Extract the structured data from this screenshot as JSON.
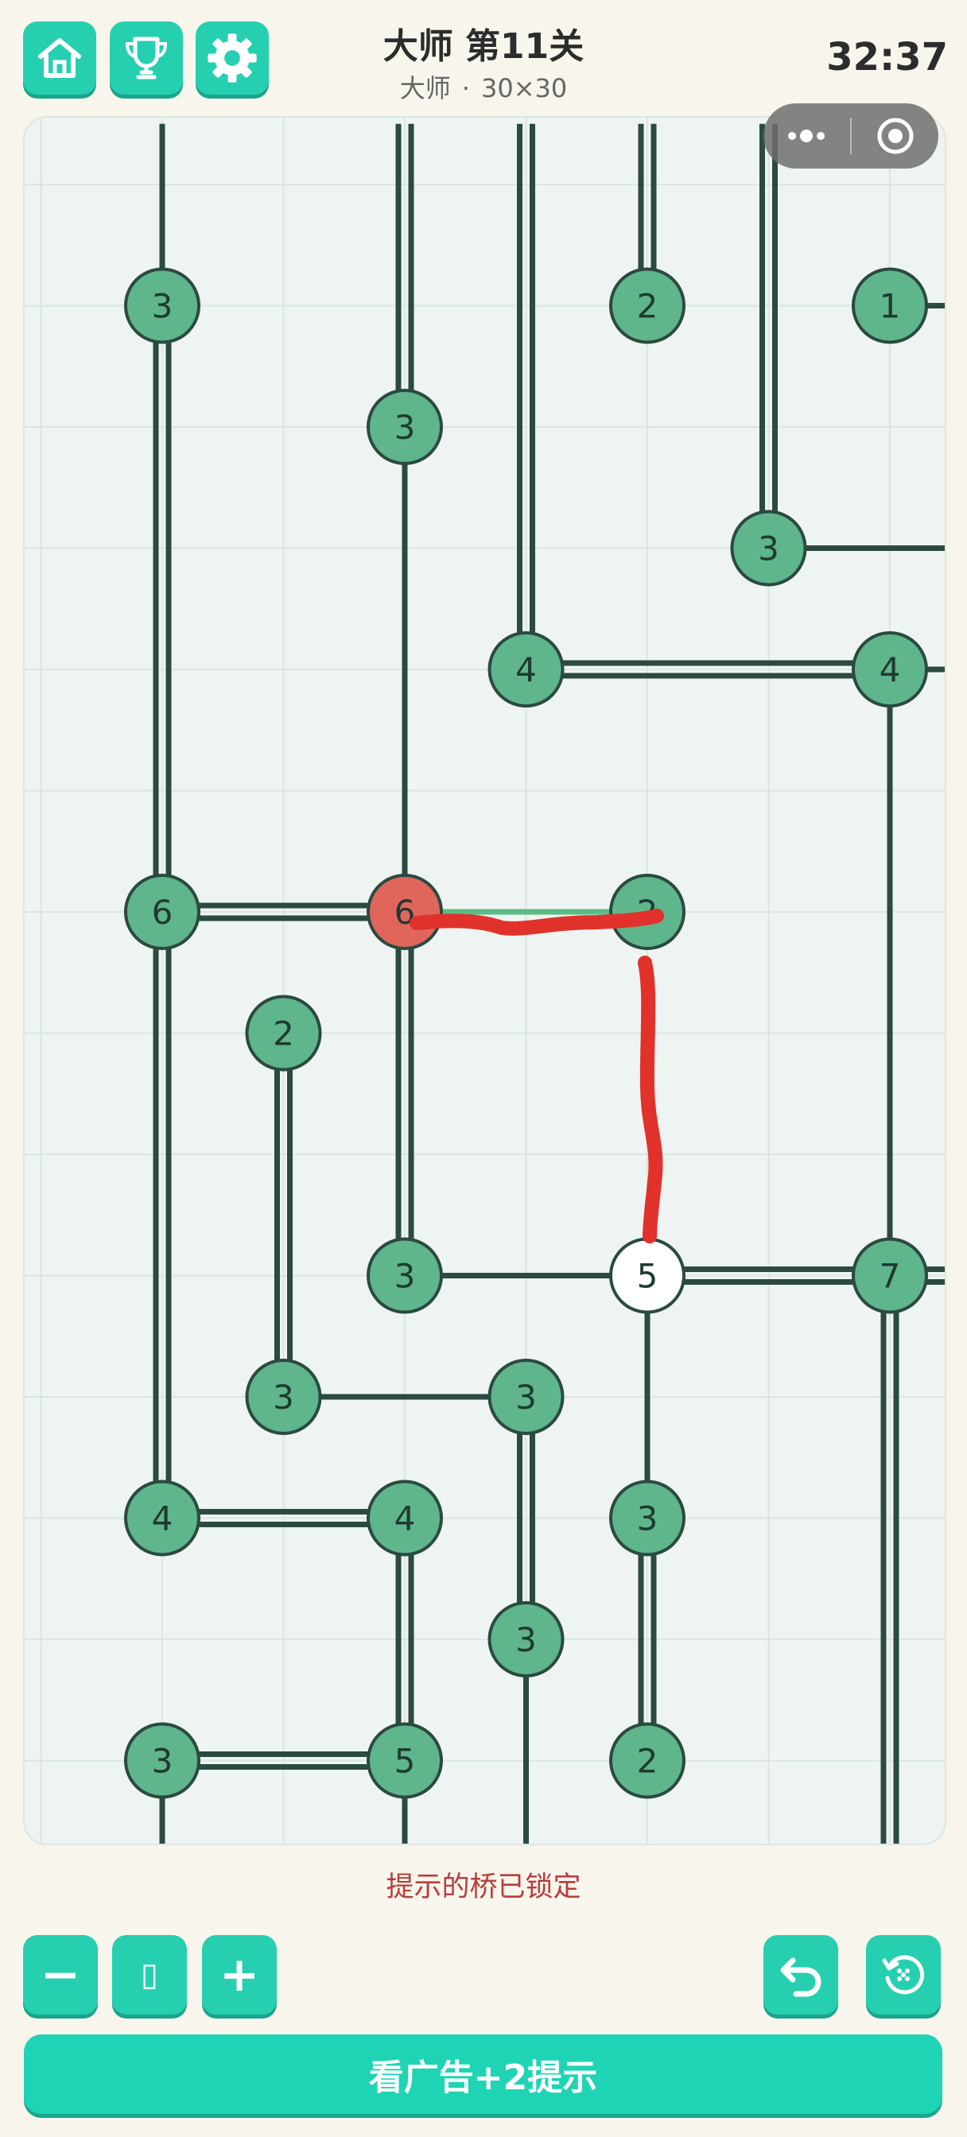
{
  "header": {
    "title": "大师 第11关",
    "difficulty": "大师",
    "separator": "·",
    "grid_size": "30×30",
    "timer": "32:37"
  },
  "toolbar_top": [
    {
      "name": "home-button",
      "icon": "home-icon"
    },
    {
      "name": "trophy-button",
      "icon": "trophy-icon"
    },
    {
      "name": "settings-button",
      "icon": "gear-icon"
    }
  ],
  "capsule": {
    "more_icon": "more-icon",
    "close_icon": "target-icon"
  },
  "colors": {
    "accent": "#27cfb1",
    "island_fill": "#5fb58c",
    "island_selected": "#e0665c",
    "island_active": "#ffffff",
    "bridge": "#2b4a40",
    "hint_bridge": "#5dbb86",
    "scribble": "#e0322a",
    "board_bg": "#eef4f1"
  },
  "islands": [
    {
      "col": 1,
      "row": 2,
      "value": "3",
      "state": "normal"
    },
    {
      "col": 5,
      "row": 2,
      "value": "2",
      "state": "normal"
    },
    {
      "col": 7,
      "row": 2,
      "value": "1",
      "state": "normal"
    },
    {
      "col": 3,
      "row": 3,
      "value": "3",
      "state": "normal"
    },
    {
      "col": 6,
      "row": 4,
      "value": "3",
      "state": "normal"
    },
    {
      "col": 4,
      "row": 5,
      "value": "4",
      "state": "normal"
    },
    {
      "col": 7,
      "row": 5,
      "value": "4",
      "state": "normal"
    },
    {
      "col": 1,
      "row": 7,
      "value": "6",
      "state": "normal"
    },
    {
      "col": 3,
      "row": 7,
      "value": "6",
      "state": "selected"
    },
    {
      "col": 5,
      "row": 7,
      "value": "2",
      "state": "normal"
    },
    {
      "col": 2,
      "row": 8,
      "value": "2",
      "state": "normal"
    },
    {
      "col": 3,
      "row": 10,
      "value": "3",
      "state": "normal"
    },
    {
      "col": 5,
      "row": 10,
      "value": "5",
      "state": "active"
    },
    {
      "col": 7,
      "row": 10,
      "value": "7",
      "state": "normal"
    },
    {
      "col": 2,
      "row": 11,
      "value": "3",
      "state": "normal"
    },
    {
      "col": 4,
      "row": 11,
      "value": "3",
      "state": "normal"
    },
    {
      "col": 1,
      "row": 12,
      "value": "4",
      "state": "normal"
    },
    {
      "col": 3,
      "row": 12,
      "value": "4",
      "state": "normal"
    },
    {
      "col": 5,
      "row": 12,
      "value": "3",
      "state": "normal"
    },
    {
      "col": 4,
      "row": 13,
      "value": "3",
      "state": "normal"
    },
    {
      "col": 1,
      "row": 14,
      "value": "3",
      "state": "normal"
    },
    {
      "col": 3,
      "row": 14,
      "value": "5",
      "state": "normal"
    },
    {
      "col": 5,
      "row": 14,
      "value": "2",
      "state": "normal"
    }
  ],
  "bridges": [
    {
      "dir": "v",
      "col": 1,
      "from": 0.5,
      "to": 2,
      "count": 1
    },
    {
      "dir": "v",
      "col": 1,
      "from": 2,
      "to": 7,
      "count": 2
    },
    {
      "dir": "v",
      "col": 1,
      "from": 7,
      "to": 12,
      "count": 2
    },
    {
      "dir": "v",
      "col": 1,
      "from": 14,
      "to": 15.4,
      "count": 1
    },
    {
      "dir": "v",
      "col": 2,
      "from": 8,
      "to": 11,
      "count": 2
    },
    {
      "dir": "v",
      "col": 3,
      "from": 0.5,
      "to": 3,
      "count": 2
    },
    {
      "dir": "v",
      "col": 3,
      "from": 3,
      "to": 7,
      "count": 1
    },
    {
      "dir": "v",
      "col": 3,
      "from": 7,
      "to": 10,
      "count": 2
    },
    {
      "dir": "v",
      "col": 3,
      "from": 12,
      "to": 14,
      "count": 2
    },
    {
      "dir": "v",
      "col": 3,
      "from": 14,
      "to": 15.4,
      "count": 1
    },
    {
      "dir": "v",
      "col": 4,
      "from": 0.5,
      "to": 5,
      "count": 2
    },
    {
      "dir": "v",
      "col": 4,
      "from": 11,
      "to": 13,
      "count": 2
    },
    {
      "dir": "v",
      "col": 4,
      "from": 13,
      "to": 15.4,
      "count": 1
    },
    {
      "dir": "v",
      "col": 5,
      "from": 0.5,
      "to": 2,
      "count": 2
    },
    {
      "dir": "v",
      "col": 5,
      "from": 10,
      "to": 12,
      "count": 1
    },
    {
      "dir": "v",
      "col": 5,
      "from": 12,
      "to": 14,
      "count": 2
    },
    {
      "dir": "v",
      "col": 6,
      "from": 0.5,
      "to": 4,
      "count": 2
    },
    {
      "dir": "v",
      "col": 7,
      "from": 5,
      "to": 10,
      "count": 1
    },
    {
      "dir": "v",
      "col": 7,
      "from": 10,
      "to": 15.4,
      "count": 2
    },
    {
      "dir": "h",
      "row": 2,
      "from": 7,
      "to": 7.6,
      "count": 1
    },
    {
      "dir": "h",
      "row": 4,
      "from": 6,
      "to": 7.6,
      "count": 1
    },
    {
      "dir": "h",
      "row": 5,
      "from": 4,
      "to": 7,
      "count": 2
    },
    {
      "dir": "h",
      "row": 5,
      "from": 7,
      "to": 7.6,
      "count": 1
    },
    {
      "dir": "h",
      "row": 7,
      "from": 1,
      "to": 3,
      "count": 2
    },
    {
      "dir": "h",
      "row": 10,
      "from": 3,
      "to": 5,
      "count": 1
    },
    {
      "dir": "h",
      "row": 10,
      "from": 5,
      "to": 7,
      "count": 2
    },
    {
      "dir": "h",
      "row": 10,
      "from": 7,
      "to": 7.6,
      "count": 2
    },
    {
      "dir": "h",
      "row": 11,
      "from": 2,
      "to": 4,
      "count": 1
    },
    {
      "dir": "h",
      "row": 12,
      "from": 1,
      "to": 3,
      "count": 2
    },
    {
      "dir": "h",
      "row": 14,
      "from": 1,
      "to": 3,
      "count": 2
    }
  ],
  "hint_bridges": [
    {
      "dir": "h",
      "row": 7,
      "from": 3,
      "to": 5
    }
  ],
  "status_message": "提示的桥已锁定",
  "bottom_controls": {
    "zoom_out_label": "−",
    "zoom_reset_label": "▯",
    "zoom_in_label": "+",
    "undo_icon": "undo-icon",
    "restart_icon": "restart-icon"
  },
  "ad_button_label": "看广告+2提示"
}
